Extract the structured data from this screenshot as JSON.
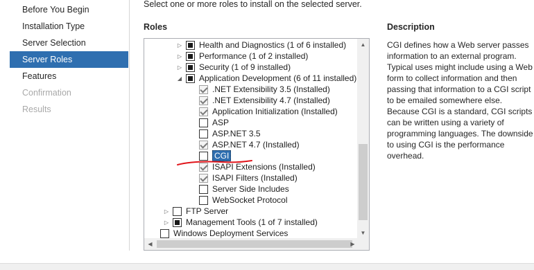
{
  "nav": {
    "items": [
      {
        "label": "Before You Begin",
        "state": "normal"
      },
      {
        "label": "Installation Type",
        "state": "normal"
      },
      {
        "label": "Server Selection",
        "state": "normal"
      },
      {
        "label": "Server Roles",
        "state": "active"
      },
      {
        "label": "Features",
        "state": "normal"
      },
      {
        "label": "Confirmation",
        "state": "disabled"
      },
      {
        "label": "Results",
        "state": "disabled"
      }
    ]
  },
  "instruction": "Select one or more roles to install on the selected server.",
  "roles_title": "Roles",
  "description_title": "Description",
  "description_text": "CGI defines how a Web server passes information to an external program. Typical uses might include using a Web form to collect information and then passing that information to a CGI script to be emailed somewhere else. Because CGI is a standard, CGI scripts can be written using a variety of programming languages. The downside to using CGI is the performance overhead.",
  "tree": [
    {
      "label": "Health and Diagnostics (1 of 6 installed)",
      "state": "partial",
      "expander": "collapsed"
    },
    {
      "label": "Performance (1 of 2 installed)",
      "state": "partial",
      "expander": "collapsed"
    },
    {
      "label": "Security (1 of 9 installed)",
      "state": "partial",
      "expander": "collapsed"
    },
    {
      "label": "Application Development (6 of 11 installed)",
      "state": "partial",
      "expander": "expanded"
    },
    {
      "label": ".NET Extensibility 3.5 (Installed)",
      "state": "checked",
      "expander": "none"
    },
    {
      "label": ".NET Extensibility 4.7 (Installed)",
      "state": "checked",
      "expander": "none"
    },
    {
      "label": "Application Initialization (Installed)",
      "state": "checked",
      "expander": "none"
    },
    {
      "label": "ASP",
      "state": "unchecked",
      "expander": "none"
    },
    {
      "label": "ASP.NET 3.5",
      "state": "unchecked",
      "expander": "none"
    },
    {
      "label": "ASP.NET 4.7 (Installed)",
      "state": "checked",
      "expander": "none"
    },
    {
      "label": "CGI",
      "state": "unchecked",
      "expander": "none",
      "selected": true
    },
    {
      "label": "ISAPI Extensions (Installed)",
      "state": "checked",
      "expander": "none"
    },
    {
      "label": "ISAPI Filters (Installed)",
      "state": "checked",
      "expander": "none"
    },
    {
      "label": "Server Side Includes",
      "state": "unchecked",
      "expander": "none"
    },
    {
      "label": "WebSocket Protocol",
      "state": "unchecked",
      "expander": "none"
    },
    {
      "label": "FTP Server",
      "state": "unchecked",
      "expander": "collapsed"
    },
    {
      "label": "Management Tools (1 of 7 installed)",
      "state": "partial",
      "expander": "collapsed"
    },
    {
      "label": "Windows Deployment Services",
      "state": "unchecked",
      "expander": "none"
    }
  ],
  "colors": {
    "accent": "#2f6fb0",
    "annotation": "#e0151b"
  },
  "icons": {
    "expander_collapsed": "triangle-right",
    "expander_expanded": "triangle-down-right",
    "scroll_up": "triangle-up",
    "scroll_down": "triangle-down",
    "scroll_left": "triangle-left",
    "scroll_right": "triangle-right"
  }
}
